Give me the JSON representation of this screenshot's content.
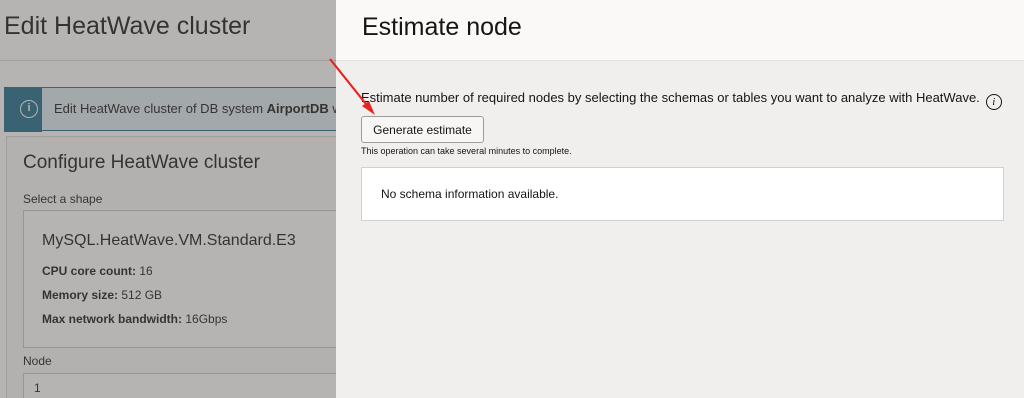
{
  "background": {
    "title": "Edit HeatWave cluster",
    "info_prefix": "Edit HeatWave cluster of DB system ",
    "info_bold": "AirportDB",
    "info_suffix": " wi",
    "card_title": "Configure HeatWave cluster",
    "shape_label": "Select a shape",
    "shape_name": "MySQL.HeatWave.VM.Standard.E3",
    "specs": [
      {
        "label": "CPU core count:",
        "value": " 16"
      },
      {
        "label": "Memory size:",
        "value": " 512 GB"
      },
      {
        "label": "Max network bandwidth:",
        "value": " 16Gbps"
      }
    ],
    "node_label": "Node",
    "node_value": "1"
  },
  "drawer": {
    "title": "Estimate node",
    "description": "Estimate number of required nodes by selecting the schemas or tables you want to analyze with HeatWave.",
    "generate_button": "Generate estimate",
    "hint": "This operation can take several minutes to complete.",
    "empty_message": "No schema information available."
  },
  "colors": {
    "annotation_arrow": "#e8231f",
    "info_accent": "#1e6a8a"
  }
}
